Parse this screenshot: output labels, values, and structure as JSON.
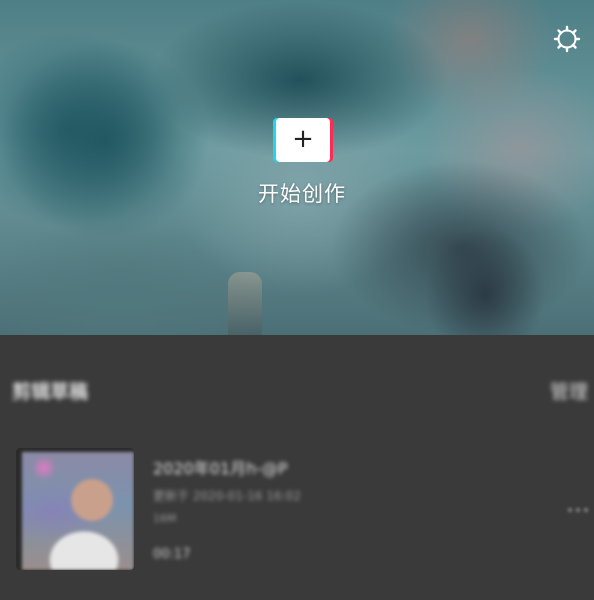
{
  "hero": {
    "create_label": "开始创作",
    "create_icon": "plus-icon",
    "settings_icon": "gear-icon",
    "accent_cyan": "#20d5ec",
    "accent_red": "#fe2c55"
  },
  "drafts": {
    "section_title": "剪辑草稿",
    "manage_label": "管理",
    "items": [
      {
        "title": "2020年01月h-@P",
        "meta": "更新于 2020-01-16 16:02",
        "size": "16M",
        "duration": "00:17",
        "more_icon": "more-icon"
      }
    ]
  }
}
